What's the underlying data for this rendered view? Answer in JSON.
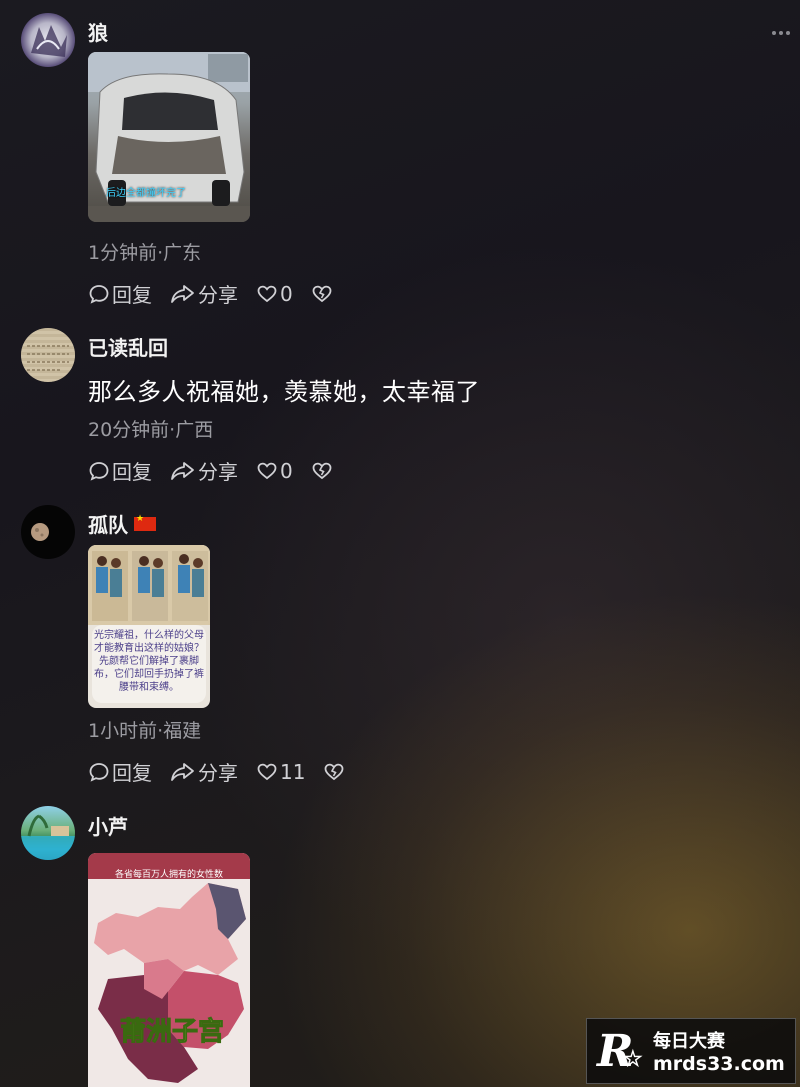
{
  "comments": [
    {
      "username": "狼",
      "image_caption": "后边全都撞坏完了",
      "meta": "1分钟前·广东",
      "reply_label": "回复",
      "share_label": "分享",
      "like_count": "0"
    },
    {
      "username": "已读乱回",
      "text": "那么多人祝福她，羡慕她，太幸福了",
      "meta": "20分钟前·广西",
      "reply_label": "回复",
      "share_label": "分享",
      "like_count": "0"
    },
    {
      "username": "孤队",
      "image_caption": "光宗耀祖，什么样的父母才能教育出这样的姑娘？先颜帮它们解掉了裹脚布，它们却回手扔掉了裤腰带和束缚。",
      "meta": "1小时前·福建",
      "reply_label": "回复",
      "share_label": "分享",
      "like_count": "11"
    },
    {
      "username": "小芦",
      "image_caption": "莆洲子宫",
      "image_header": "各省每百万人拥有的女性数"
    }
  ],
  "watermark": {
    "line1": "每日大赛",
    "line2": "mrds33.com",
    "mark": "R"
  },
  "colors": {
    "text_primary": "#ffffff",
    "text_secondary": "#9c9ca2",
    "background": "#1b1a20",
    "accent_glow": "#96762f"
  }
}
